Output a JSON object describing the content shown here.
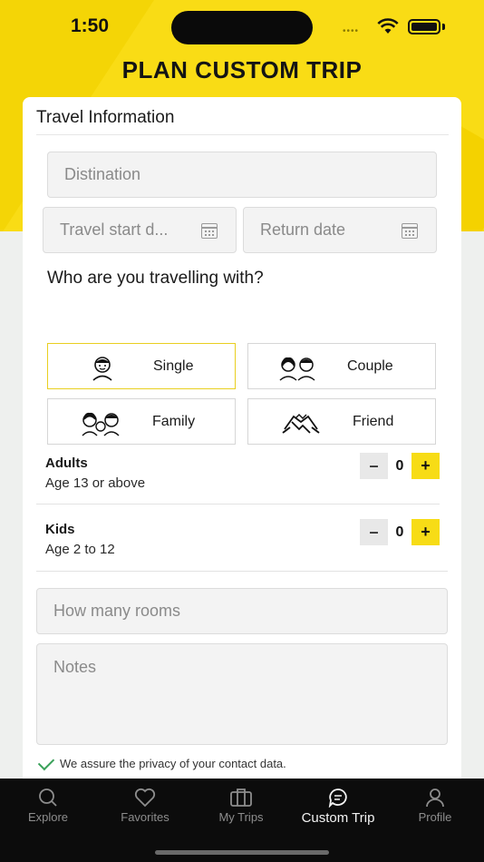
{
  "status_bar": {
    "time": "1:50"
  },
  "page": {
    "title": "PLAN CUSTOM TRIP"
  },
  "form": {
    "section_title": "Travel Information",
    "destination_placeholder": "Distination",
    "start_date_placeholder": "Travel start d...",
    "return_date_placeholder": "Return date",
    "question": "Who are you travelling with?",
    "options": [
      {
        "label": "Single",
        "icon": "single-person-icon",
        "selected": true
      },
      {
        "label": "Couple",
        "icon": "couple-icon",
        "selected": false
      },
      {
        "label": "Family",
        "icon": "family-icon",
        "selected": false
      },
      {
        "label": "Friend",
        "icon": "friend-handshake-icon",
        "selected": false
      }
    ],
    "adults": {
      "title": "Adults",
      "subtitle": "Age 13 or above",
      "value": "0",
      "minus": "–",
      "plus": "+"
    },
    "kids": {
      "title": "Kids",
      "subtitle": "Age 2 to 12",
      "value": "0",
      "minus": "–",
      "plus": "+"
    },
    "rooms_placeholder": "How many rooms",
    "notes_placeholder": "Notes",
    "privacy_text": "We assure the privacy of your contact data."
  },
  "tabbar": {
    "tabs": [
      {
        "label": "Explore",
        "icon": "search-icon"
      },
      {
        "label": "Favorites",
        "icon": "heart-icon"
      },
      {
        "label": "My Trips",
        "icon": "suitcase-icon"
      },
      {
        "label": "Custom Trip",
        "icon": "chat-icon",
        "active": true
      },
      {
        "label": "Profile",
        "icon": "person-icon"
      }
    ]
  },
  "colors": {
    "accent": "#f9dc15",
    "tabbar": "#0c0c0c",
    "check": "#3aa15a"
  }
}
